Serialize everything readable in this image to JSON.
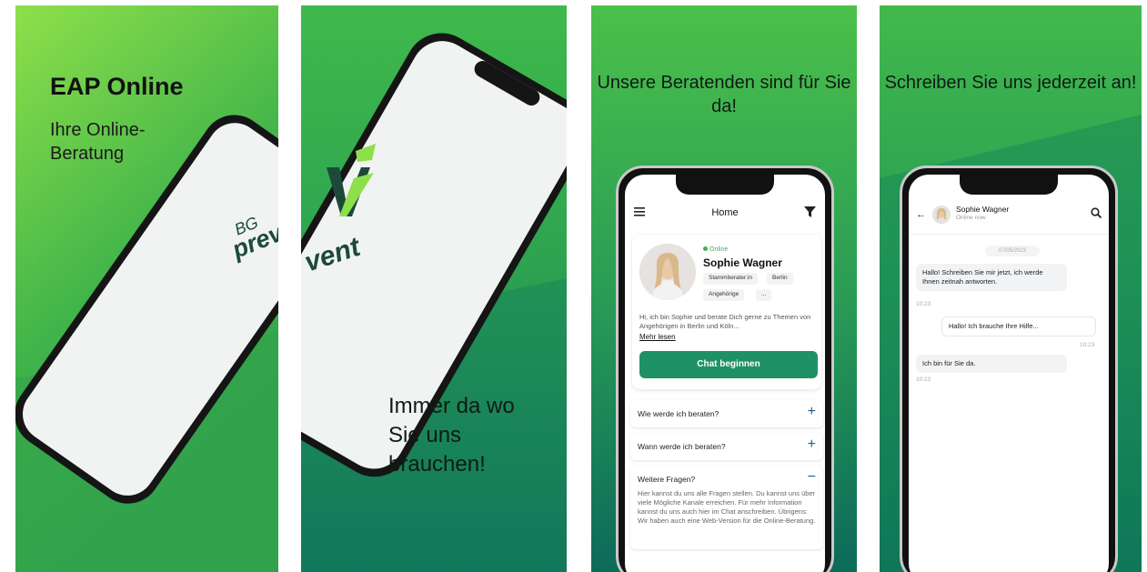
{
  "panel1": {
    "title": "EAP Online",
    "subtitle": "Ihre Online-Beratung",
    "brand_small": "BG",
    "brand_big": "prev"
  },
  "panel2": {
    "brand_suffix": "vent",
    "tagline": "Immer da wo Sie uns brauchen!"
  },
  "panel3": {
    "headline": "Unsere Beratenden sind für Sie da!",
    "topbar_title": "Home",
    "counselor": {
      "status": "Online",
      "name": "Sophie Wagner",
      "tags": [
        "Stammberater:in",
        "Berlin",
        "Angehörige",
        "..."
      ],
      "bio": "Hi, ich bin Sophie und berate Dich gerne zu Themen von Angehörigen in Berlin und Köln...",
      "more_link": "Mehr lesen",
      "chat_button": "Chat beginnen"
    },
    "faq": [
      {
        "question": "Wie werde ich beraten?",
        "toggle": "+"
      },
      {
        "question": "Wann werde ich beraten?",
        "toggle": "+"
      },
      {
        "question": "Weitere Fragen?",
        "toggle": "−",
        "answer": "Hier kannst du uns alle Fragen stellen. Du kannst uns über viele Mögliche Kanale erreichen. Für mehr Information kannst du uns auch hier im Chat anschreiben. Übrigens: Wir haben auch eine Web-Version für die Online-Beratung."
      }
    ]
  },
  "panel4": {
    "headline": "Schreiben Sie uns jederzeit an!",
    "chat": {
      "name": "Sophie Wagner",
      "status": "Online now",
      "date": "07/05/2023",
      "messages": [
        {
          "text": "Hallo! Schreiben Sie mir jetzt, ich werde Ihnen zeitnah antworten.",
          "time": "10:23",
          "direction": "in"
        },
        {
          "text": "Hallo! Ich brauche Ihre Hilfe...",
          "time": "10:23",
          "direction": "out"
        },
        {
          "text": "Ich bin für Sie da.",
          "time": "10:23",
          "direction": "in"
        }
      ]
    }
  },
  "colors": {
    "green_light": "#8ee04a",
    "green_mid": "#3eb84a",
    "green_dark": "#0c6b5a",
    "brand_dark": "#1c4a3a",
    "button": "#1f9167"
  }
}
